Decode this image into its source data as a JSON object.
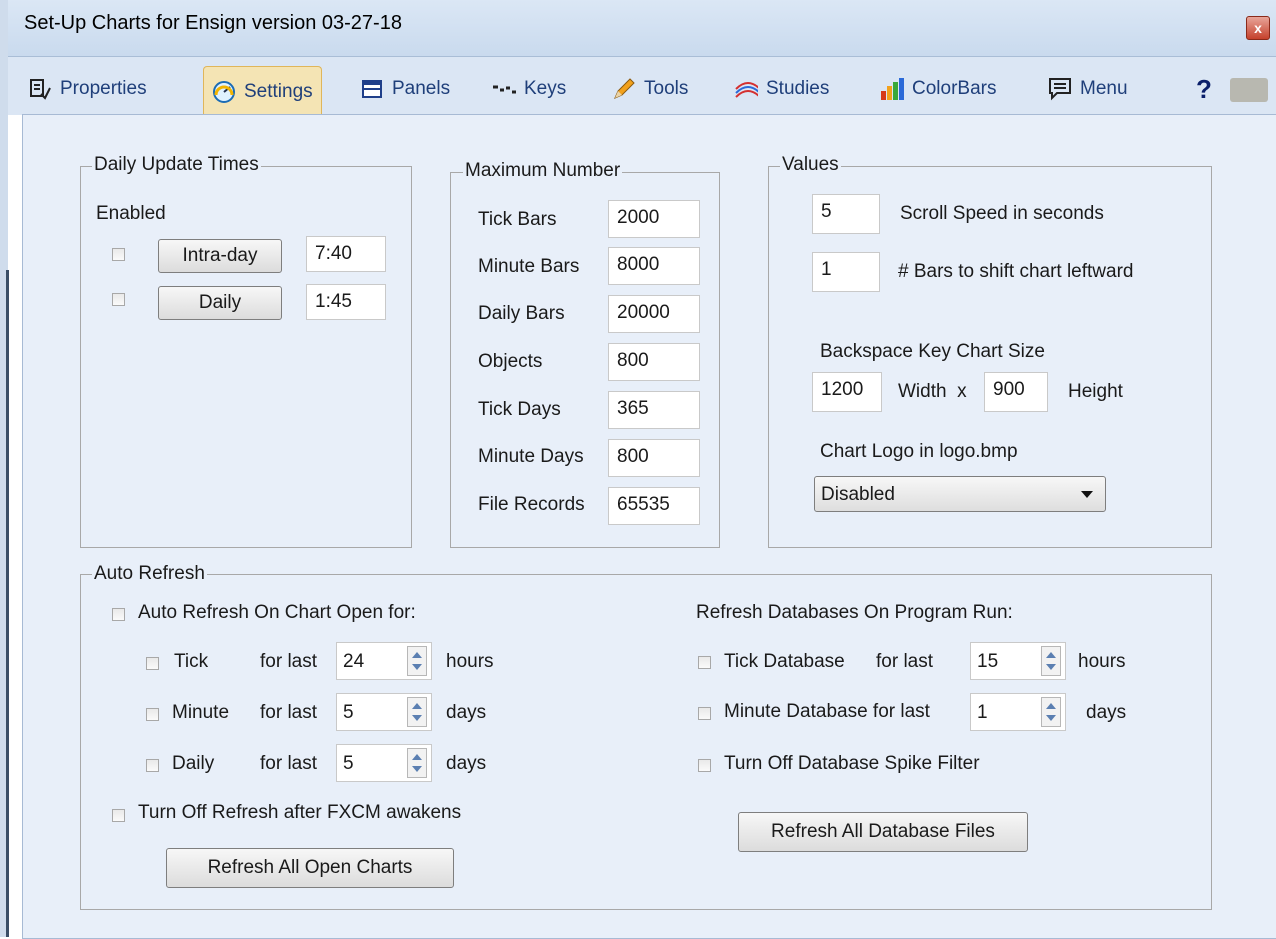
{
  "window": {
    "title": "Set-Up Charts for Ensign version 03-27-18",
    "close": "x"
  },
  "tabs": [
    {
      "label": "Properties",
      "icon": "properties-icon"
    },
    {
      "label": "Settings",
      "icon": "gauge-icon"
    },
    {
      "label": "Panels",
      "icon": "panels-icon"
    },
    {
      "label": "Keys",
      "icon": "keys-icon"
    },
    {
      "label": "Tools",
      "icon": "pencil-icon"
    },
    {
      "label": "Studies",
      "icon": "wave-icon"
    },
    {
      "label": "ColorBars",
      "icon": "colorbars-icon"
    },
    {
      "label": "Menu",
      "icon": "menu-icon"
    }
  ],
  "help": "?",
  "daily_update": {
    "legend": "Daily Update Times",
    "enabled_label": "Enabled",
    "intraday_button": "Intra-day",
    "intraday_time": "7:40",
    "daily_button": "Daily",
    "daily_time": "1:45"
  },
  "maximum_number": {
    "legend": "Maximum Number",
    "rows": [
      {
        "label": "Tick Bars",
        "value": "2000"
      },
      {
        "label": "Minute Bars",
        "value": "8000"
      },
      {
        "label": "Daily Bars",
        "value": "20000"
      },
      {
        "label": "Objects",
        "value": "800"
      },
      {
        "label": "Tick Days",
        "value": "365"
      },
      {
        "label": "Minute Days",
        "value": "800"
      },
      {
        "label": "File Records",
        "value": "65535"
      }
    ]
  },
  "values": {
    "legend": "Values",
    "scroll_speed_value": "5",
    "scroll_speed_label": "Scroll Speed in seconds",
    "shift_value": "1",
    "shift_label": "# Bars to shift chart leftward",
    "backspace_label": "Backspace Key Chart Size",
    "width_value": "1200",
    "width_label": "Width  x",
    "height_value": "900",
    "height_label": "Height",
    "logo_label": "Chart Logo in logo.bmp",
    "logo_selected": "Disabled"
  },
  "auto_refresh": {
    "legend": "Auto Refresh",
    "on_open_label": "Auto Refresh On Chart Open for:",
    "rows": [
      {
        "name": "Tick",
        "for_last": "for last",
        "value": "24",
        "unit": "hours"
      },
      {
        "name": "Minute",
        "for_last": "for last",
        "value": "5",
        "unit": "days"
      },
      {
        "name": "Daily",
        "for_last": "for last",
        "value": "5",
        "unit": "days"
      }
    ],
    "turn_off_label": "Turn Off Refresh after FXCM awakens",
    "refresh_open_button": "Refresh All Open Charts",
    "db_header": "Refresh Databases On Program Run:",
    "tick_db_label": "Tick Database",
    "tick_db_for": "for last",
    "tick_db_value": "15",
    "tick_db_unit": "hours",
    "minute_db_label": "Minute Database for last",
    "minute_db_value": "1",
    "minute_db_unit": "days",
    "spike_label": "Turn Off Database Spike Filter",
    "refresh_db_button": "Refresh All Database Files"
  }
}
